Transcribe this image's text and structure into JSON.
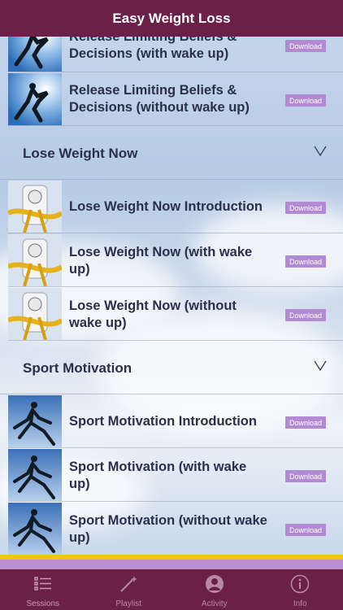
{
  "header": {
    "title": "Easy Weight Loss"
  },
  "rows_top": [
    {
      "title_line1": "Release Limiting Beliefs &",
      "title_line2": "Decisions (with wake up)",
      "download": "Download",
      "thumb": "jumping-person-sky"
    },
    {
      "title_line1": "Release Limiting Beliefs &",
      "title_line2": "Decisions (without wake up)",
      "download": "Download",
      "thumb": "jumping-person-sky"
    }
  ],
  "sections": [
    {
      "title": "Lose Weight Now",
      "icon": "chevron-down-icon",
      "items": [
        {
          "title_line1": "Lose Weight Now Introduction",
          "title_line2": "",
          "download": "Download",
          "thumb": "scale-tape-measure"
        },
        {
          "title_line1": "Lose Weight Now (with wake",
          "title_line2": "up)",
          "download": "Download",
          "thumb": "scale-tape-measure"
        },
        {
          "title_line1": "Lose Weight Now (without",
          "title_line2": "wake up)",
          "download": "Download",
          "thumb": "scale-tape-measure"
        }
      ]
    },
    {
      "title": "Sport Motivation",
      "icon": "chevron-down-icon",
      "items": [
        {
          "title_line1": "Sport Motivation Introduction",
          "title_line2": "",
          "download": "Download",
          "thumb": "runner-sky"
        },
        {
          "title_line1": "Sport Motivation (with wake",
          "title_line2": "up)",
          "download": "Download",
          "thumb": "runner-sky"
        },
        {
          "title_line1": "Sport Motivation (without wake",
          "title_line2": "up)",
          "download": "Download",
          "thumb": "runner-sky"
        }
      ]
    }
  ],
  "tabs": [
    {
      "label": "Sessions",
      "icon": "list-icon",
      "active": true
    },
    {
      "label": "Playlist",
      "icon": "magic-wand-icon",
      "active": false
    },
    {
      "label": "Activity",
      "icon": "user-icon",
      "active": false
    },
    {
      "label": "Info",
      "icon": "info-icon",
      "active": false
    }
  ],
  "colors": {
    "bar": "#6b2147",
    "download": "#b28ad2",
    "gold": "#f1c415"
  }
}
